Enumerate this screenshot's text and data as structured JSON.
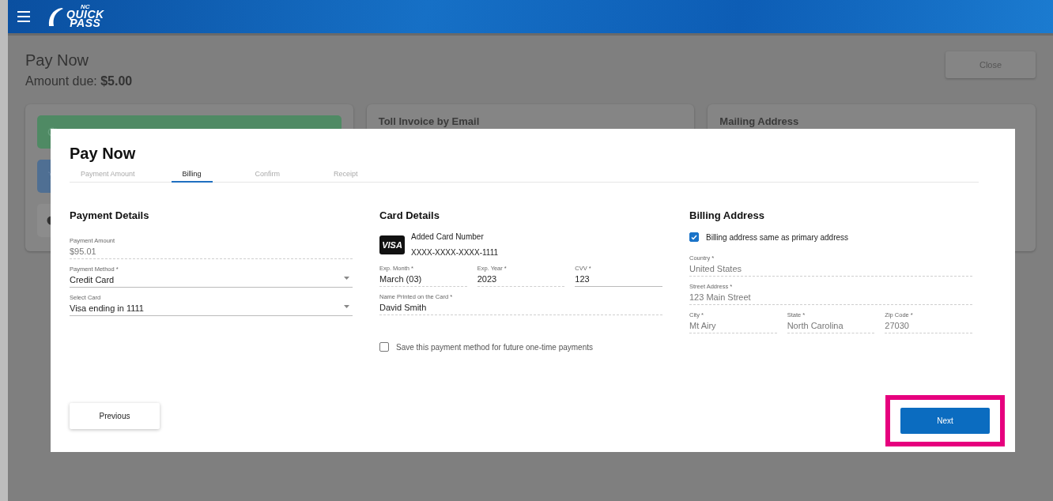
{
  "header": {
    "logo": {
      "top": "NC",
      "middle": "QUICK",
      "bottom": "PASS"
    }
  },
  "page": {
    "title": "Pay Now",
    "amount_label": "Amount due:",
    "amount": "$5.00",
    "close_button": "Close"
  },
  "cards": [
    {
      "kind": "actions",
      "actions": [
        {
          "color": "#4f8a64"
        },
        {
          "color": "#4f6f93"
        },
        {
          "color": "#8c8c8c"
        }
      ]
    },
    {
      "kind": "titled",
      "title": "Toll Invoice by Email"
    },
    {
      "kind": "titled",
      "title": "Mailing Address"
    }
  ],
  "dialog": {
    "title": "Pay Now",
    "steps": [
      {
        "label": "Payment Amount",
        "selected": false
      },
      {
        "label": "Billing",
        "selected": true
      },
      {
        "label": "Confirm",
        "selected": false
      },
      {
        "label": "Receipt",
        "selected": false
      }
    ],
    "sections": [
      {
        "title": "Payment Details",
        "items": [
          {
            "kind": "fields",
            "fields": [
              {
                "kind": "static",
                "label": "Payment Amount",
                "value": "$95.01"
              }
            ]
          },
          {
            "kind": "fields",
            "fields": [
              {
                "kind": "select",
                "label": "Payment Method *",
                "value": "Credit Card"
              }
            ]
          },
          {
            "kind": "fields",
            "fields": [
              {
                "kind": "select",
                "label": "Select Card",
                "value": "Visa ending in 1111"
              }
            ]
          }
        ]
      },
      {
        "title": "Card Details",
        "items": [
          {
            "kind": "card",
            "brand": "VISA",
            "label": "Added Card Number",
            "number": "XXXX-XXXX-XXXX-1111"
          },
          {
            "kind": "fields",
            "fields": [
              {
                "kind": "filled",
                "label": "Exp. Month *",
                "value": "March (03)"
              },
              {
                "kind": "filled",
                "label": "Exp. Year *",
                "value": "2023"
              },
              {
                "kind": "input",
                "label": "CVV *",
                "value": "123"
              }
            ]
          },
          {
            "kind": "fields",
            "fields": [
              {
                "kind": "filled",
                "label": "Name Printed on the Card *",
                "value": "David Smith"
              }
            ]
          },
          {
            "kind": "checkbox",
            "label": "Save this payment method for future one-time payments",
            "checked": false
          }
        ]
      },
      {
        "title": "Billing Address",
        "items": [
          {
            "kind": "checkbox",
            "label": "Billing address same as primary address",
            "checked": true
          },
          {
            "kind": "fields",
            "fields": [
              {
                "kind": "static",
                "label": "Country *",
                "value": "United States"
              }
            ]
          },
          {
            "kind": "fields",
            "fields": [
              {
                "kind": "static",
                "label": "Street Address *",
                "value": "123 Main Street"
              }
            ]
          },
          {
            "kind": "fields",
            "fields": [
              {
                "kind": "static",
                "label": "City *",
                "value": "Mt Airy"
              },
              {
                "kind": "static",
                "label": "State *",
                "value": "North Carolina"
              },
              {
                "kind": "static",
                "label": "Zip Code *",
                "value": "27030"
              }
            ]
          }
        ]
      }
    ],
    "footer": {
      "previous": "Previous",
      "next": "Next",
      "next_highlighted": true
    }
  }
}
